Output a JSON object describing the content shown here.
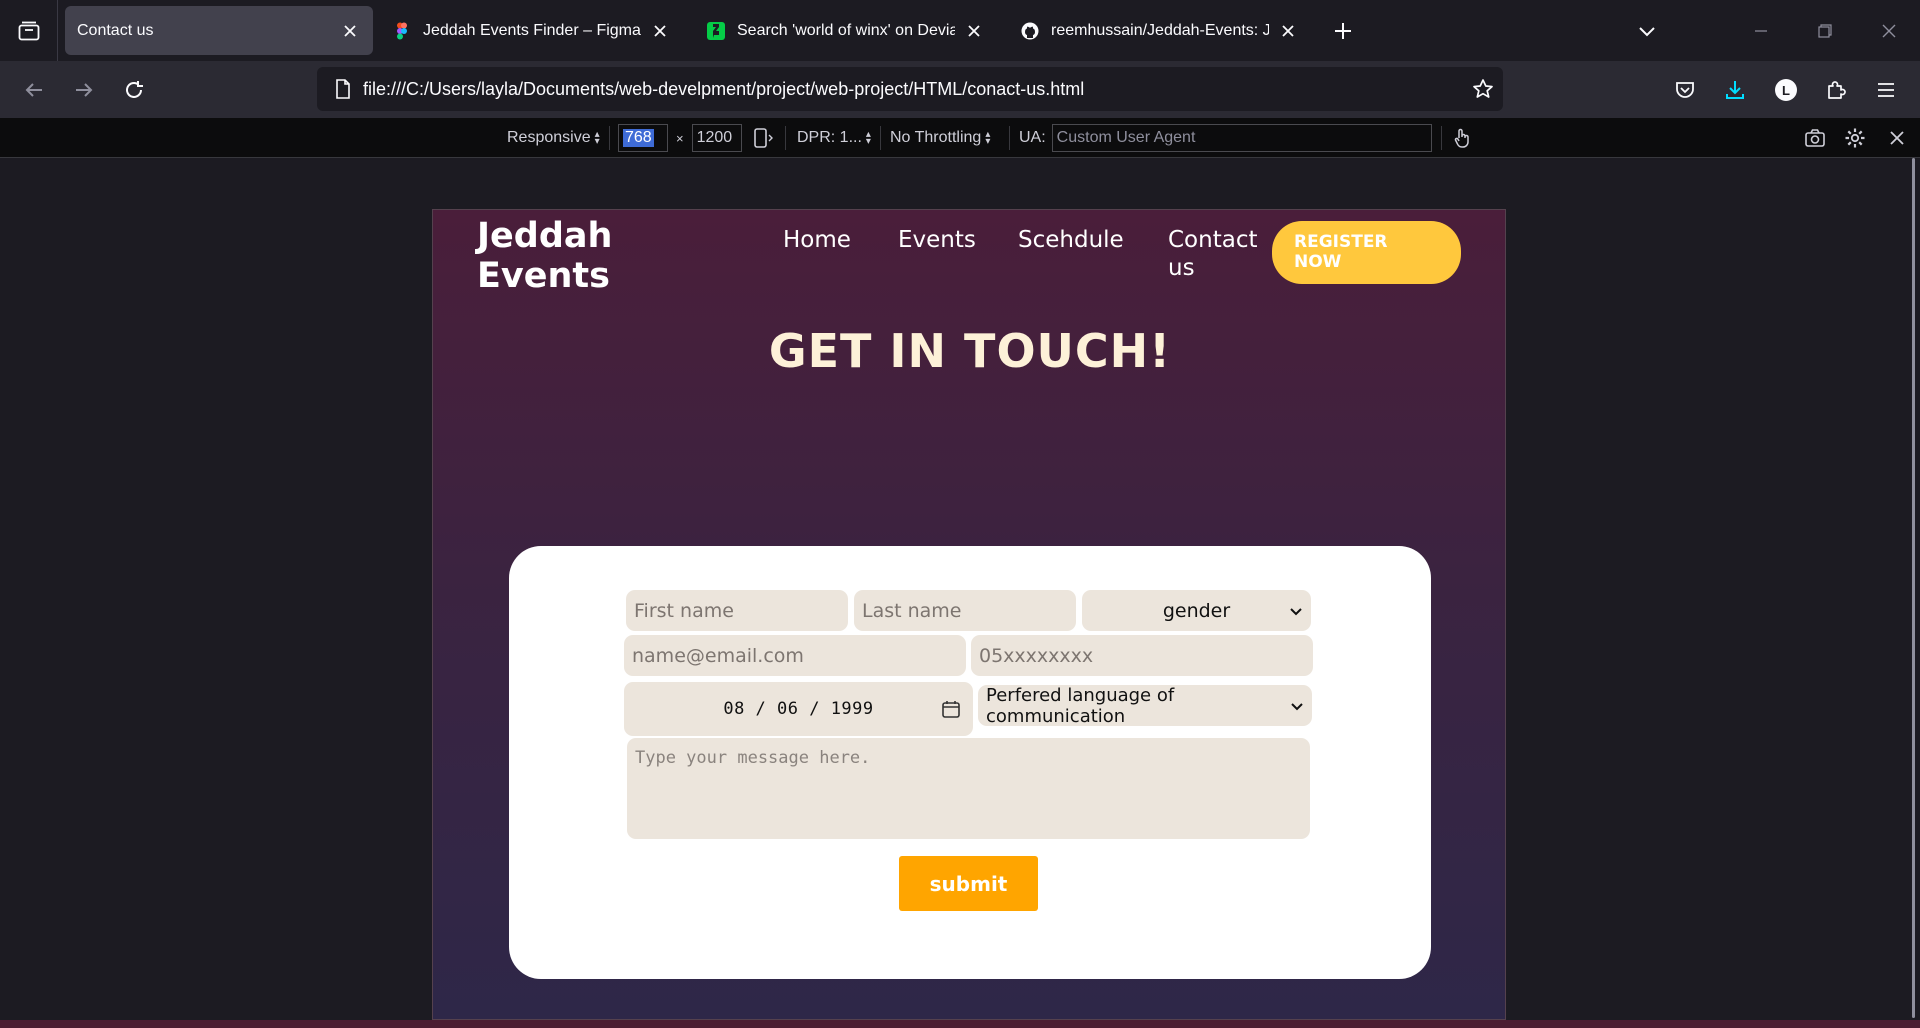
{
  "browser": {
    "tabs": [
      {
        "title": "Contact us",
        "active": true
      },
      {
        "title": "Jeddah Events Finder – Figma",
        "active": false
      },
      {
        "title": "Search 'world of winx' on DeviantArt",
        "active": false
      },
      {
        "title": "reemhussain/Jeddah-Events: Jeddah Events",
        "active": false
      }
    ],
    "url": "file:///C:/Users/layla/Documents/web-develpment/project/web-project/HTML/conact-us.html",
    "profile_initial": "L"
  },
  "rdm": {
    "device": "Responsive",
    "width": "768",
    "times": "×",
    "height": "1200",
    "dpr": "DPR: 1...",
    "throttling": "No Throttling",
    "ua_label": "UA:",
    "ua_placeholder": "Custom User Agent"
  },
  "site": {
    "logo_line1": "Jeddah",
    "logo_line2": "Events",
    "nav": {
      "home": "Home",
      "events": "Events",
      "schedule": "Scehdule",
      "contact_line1": "Contact",
      "contact_line2": "us"
    },
    "register_line1": "REGISTER",
    "register_line2": "NOW",
    "heading": "GET IN TOUCH!"
  },
  "form": {
    "first_name_placeholder": "First name",
    "last_name_placeholder": "Last name",
    "gender_value": "gender",
    "email_placeholder": "name@email.com",
    "phone_placeholder": "05xxxxxxxx",
    "date_value": "08 / 06 / 1999",
    "language_value": "Perfered language of communication",
    "message_placeholder": "Type your message here.",
    "submit_label": "submit"
  },
  "colors": {
    "accent_yellow": "#ffc83d",
    "submit_orange": "#ffa500",
    "field_bg": "#ece5dc",
    "heading_cream": "#fdf1d8"
  }
}
